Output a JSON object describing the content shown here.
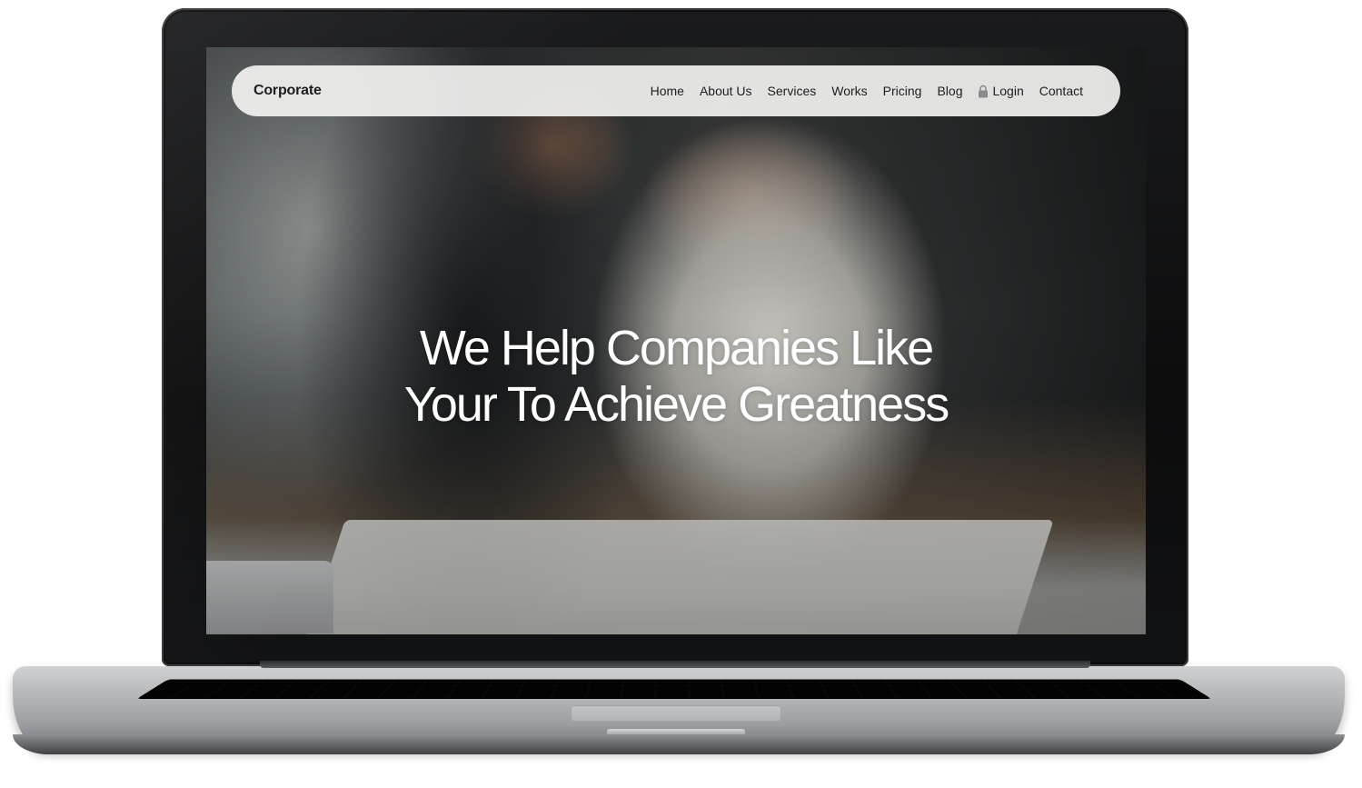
{
  "navbar": {
    "brand": "Corporate",
    "links": [
      {
        "label": "Home"
      },
      {
        "label": "About Us"
      },
      {
        "label": "Services"
      },
      {
        "label": "Works"
      },
      {
        "label": "Pricing"
      },
      {
        "label": "Blog"
      },
      {
        "label": "Login",
        "icon": "lock-icon"
      },
      {
        "label": "Contact"
      }
    ]
  },
  "hero": {
    "headline_line1": "We Help Companies Like",
    "headline_line2": "Your To Achieve Greatness"
  },
  "colors": {
    "navbar_bg": "#f2f2f0",
    "headline_text": "#ffffff",
    "nav_text": "#1e1e1e"
  }
}
